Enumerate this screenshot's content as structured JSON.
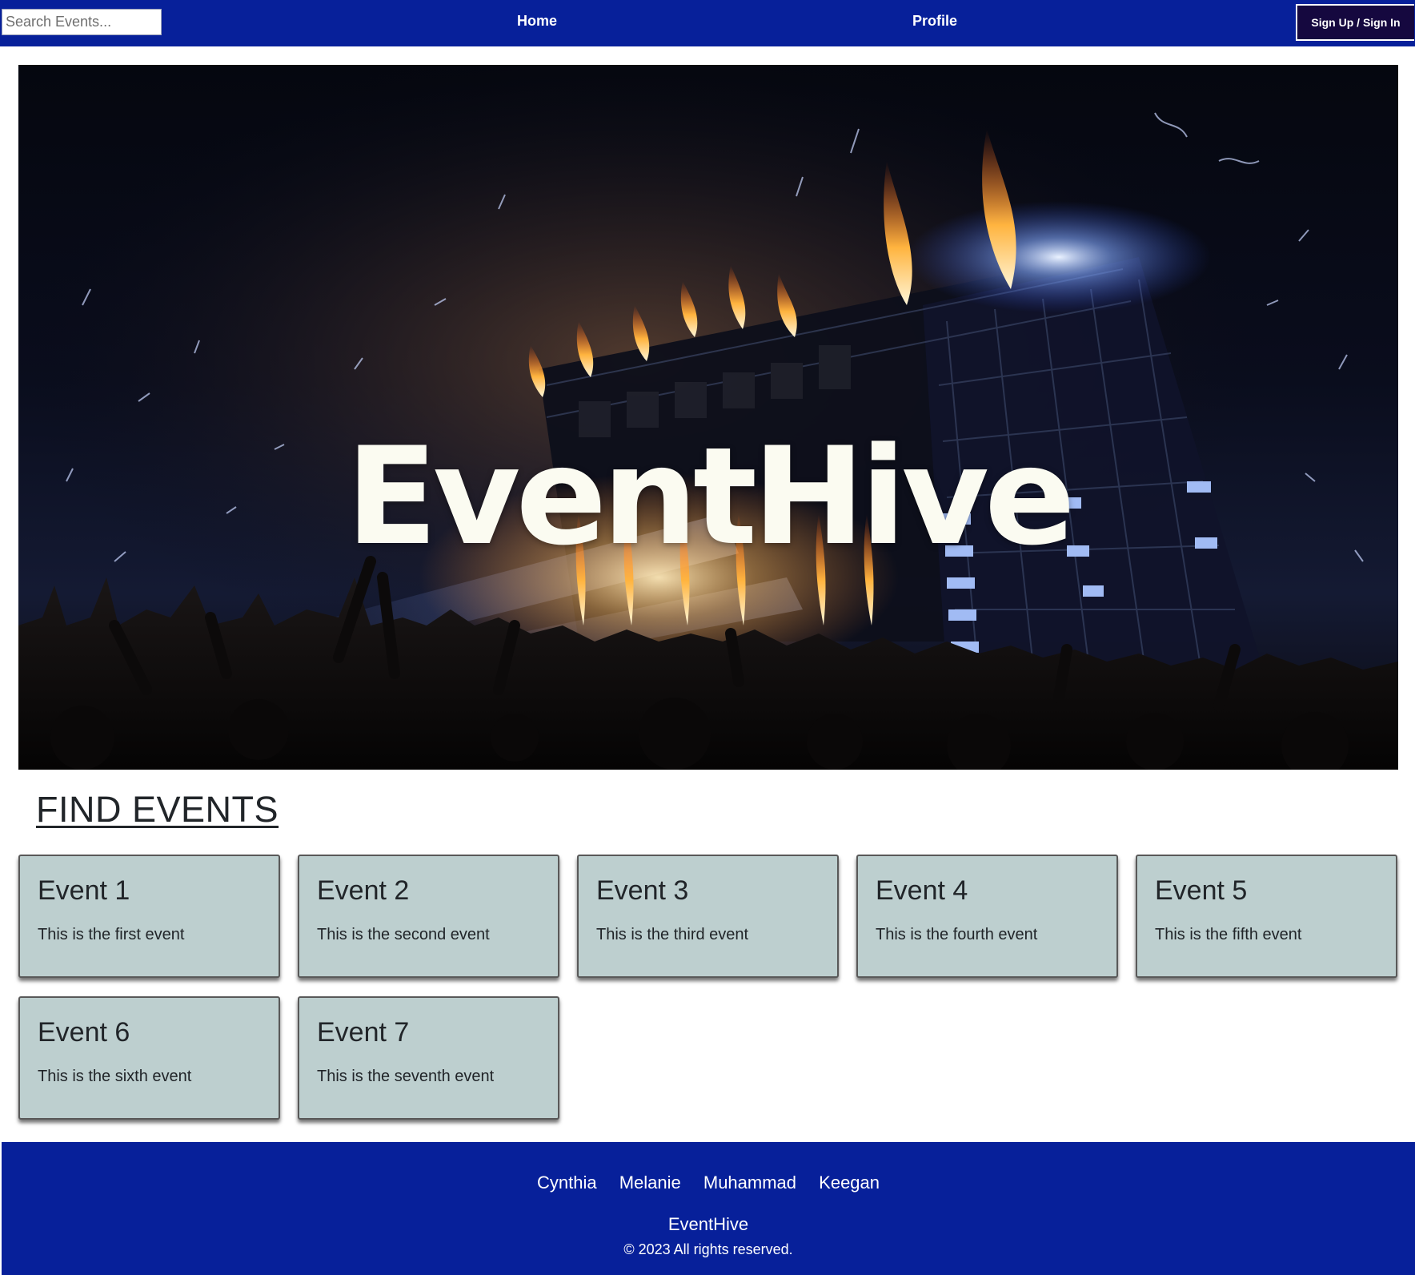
{
  "nav": {
    "search_placeholder": "Search Events...",
    "search_value": "",
    "home_label": "Home",
    "profile_label": "Profile",
    "signup_label": "Sign Up / Sign In"
  },
  "hero": {
    "title": "EventHive",
    "image": "concert-stage-crowd-photo"
  },
  "events_section": {
    "title": "FIND EVENTS",
    "events": [
      {
        "title": "Event 1",
        "description": "This is the first event"
      },
      {
        "title": "Event 2",
        "description": "This is the second event"
      },
      {
        "title": "Event 3",
        "description": "This is the third event"
      },
      {
        "title": "Event 4",
        "description": "This is the fourth event"
      },
      {
        "title": "Event 5",
        "description": "This is the fifth event"
      },
      {
        "title": "Event 6",
        "description": "This is the sixth event"
      },
      {
        "title": "Event 7",
        "description": "This is the seventh event"
      }
    ]
  },
  "footer": {
    "names": [
      "Cynthia",
      "Melanie",
      "Muhammad",
      "Keegan"
    ],
    "brand": "EventHive",
    "copyright": "© 2023 All rights reserved."
  },
  "colors": {
    "nav_background": "#07209a",
    "signup_background": "#15083f",
    "card_background": "#bdcfcf",
    "footer_background": "#07209a",
    "text_dark": "#212529"
  }
}
